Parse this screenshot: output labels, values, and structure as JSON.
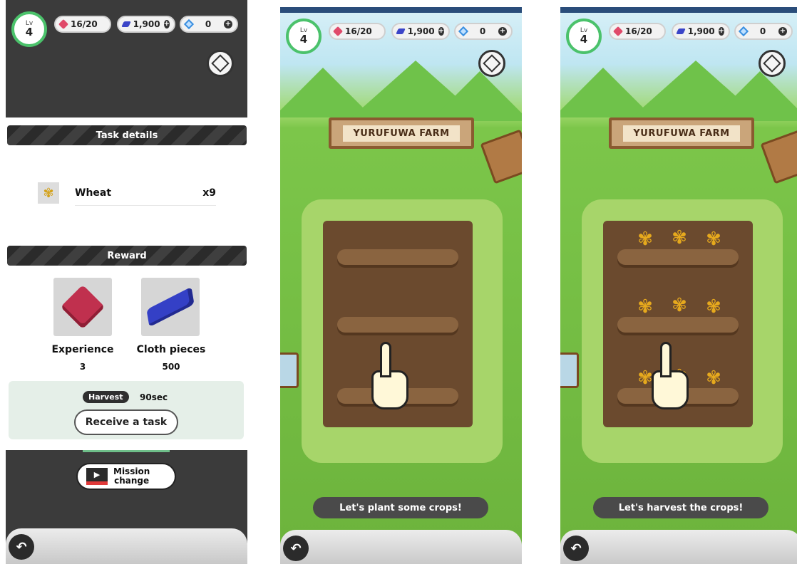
{
  "hud": {
    "level_label": "Lv",
    "level_value": "4",
    "hearts": "16/20",
    "cloth": "1,900",
    "gems": "0",
    "plus": "+"
  },
  "task_panel": {
    "section_title": "Task details",
    "item_name": "Wheat",
    "item_qty": "x9",
    "reward_title": "Reward",
    "rewards": [
      {
        "label": "Experience",
        "value": "3"
      },
      {
        "label": "Cloth pieces",
        "value": "500"
      }
    ],
    "harvest_chip": "Harvest",
    "harvest_time": "90sec",
    "receive_button": "Receive a task",
    "mission_line1": "Mission",
    "mission_line2": "change"
  },
  "farm": {
    "sign": "YURUFUWA FARM",
    "msg_plant": "Let's plant some crops!",
    "msg_harvest": "Let's harvest the crops!"
  },
  "icons": {
    "back": "back-arrow-icon",
    "box": "cube-icon"
  }
}
